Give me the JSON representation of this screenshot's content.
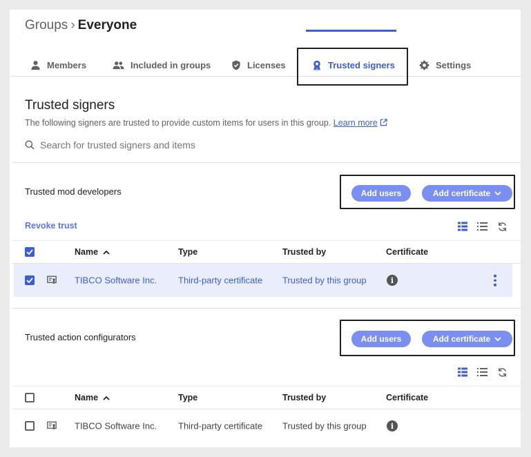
{
  "breadcrumb": {
    "parent": "Groups",
    "separator": "›",
    "current": "Everyone"
  },
  "tabs": [
    {
      "label": "Members",
      "icon": "person-icon"
    },
    {
      "label": "Included in groups",
      "icon": "people-icon"
    },
    {
      "label": "Licenses",
      "icon": "shield-icon"
    },
    {
      "label": "Trusted signers",
      "icon": "ribbon-icon",
      "active": true
    },
    {
      "label": "Settings",
      "icon": "gear-icon"
    }
  ],
  "page": {
    "title": "Trusted signers",
    "description": "The following signers are trusted to provide custom items for users in this group.",
    "learn_more": "Learn more",
    "search_placeholder": "Search for trusted signers and items"
  },
  "sections": [
    {
      "title": "Trusted mod developers",
      "add_users": "Add users",
      "add_certificate": "Add certificate",
      "revoke": "Revoke trust",
      "columns": [
        "Name",
        "Type",
        "Trusted by",
        "Certificate"
      ],
      "header_checked": true,
      "rows": [
        {
          "name": "TIBCO Software Inc.",
          "type": "Third-party certificate",
          "trusted_by": "Trusted by this group",
          "certificate": "i",
          "checked": true
        }
      ]
    },
    {
      "title": "Trusted action configurators",
      "add_users": "Add users",
      "add_certificate": "Add certificate",
      "columns": [
        "Name",
        "Type",
        "Trusted by",
        "Certificate"
      ],
      "header_checked": false,
      "rows": [
        {
          "name": "TIBCO Software Inc.",
          "type": "Third-party certificate",
          "trusted_by": "Trusted by this group",
          "certificate": "i",
          "checked": false
        }
      ]
    }
  ],
  "colors": {
    "accent": "#3d5ecf",
    "button": "#7a8ff0",
    "selected_row": "#eaedfc",
    "highlight_box": "#1f1f1f"
  }
}
